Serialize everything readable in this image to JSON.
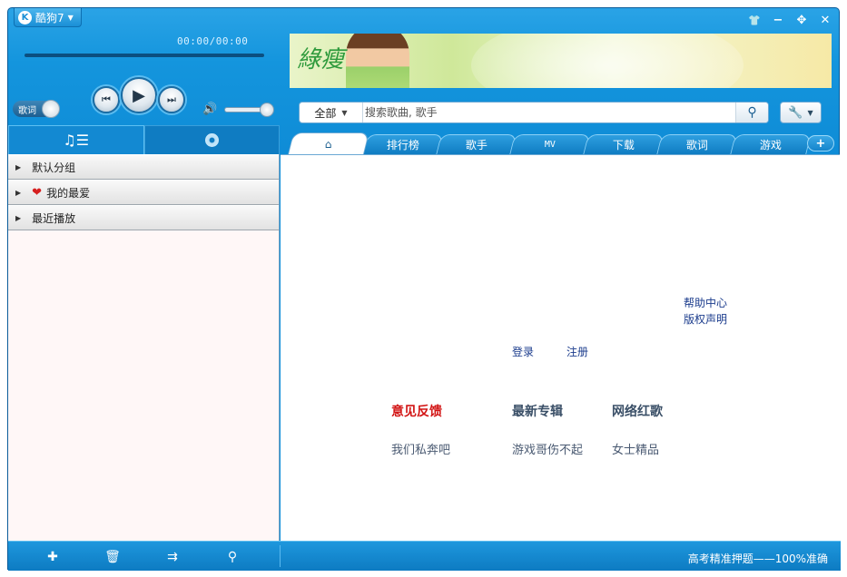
{
  "app": {
    "title": "酷狗7",
    "logo_letter": "K"
  },
  "window_controls": {
    "skin": "👕",
    "minimize": "−",
    "mini_mode": "✥",
    "close": "✕"
  },
  "player": {
    "time": "00:00/00:00",
    "progress": 0,
    "lyric_toggle": "歌词",
    "volume_level": 0.85
  },
  "banner": {
    "text": "綠瘦"
  },
  "search": {
    "scope": "全部",
    "placeholder": "搜索歌曲, 歌手",
    "value": ""
  },
  "left_tabs": [
    {
      "name": "music-list",
      "icon": "music-list-icon",
      "active": true
    },
    {
      "name": "disc",
      "icon": "disc-icon",
      "active": false
    }
  ],
  "groups": [
    {
      "label": "默认分组",
      "icon": null
    },
    {
      "label": "我的最爱",
      "icon": "heart-icon"
    },
    {
      "label": "最近播放",
      "icon": null
    }
  ],
  "tabs": [
    {
      "label": "home",
      "icon": "home-icon"
    },
    {
      "label": "排行榜"
    },
    {
      "label": "歌手"
    },
    {
      "label": "MV"
    },
    {
      "label": "下载"
    },
    {
      "label": "歌词"
    },
    {
      "label": "游戏"
    }
  ],
  "content": {
    "help": "帮助中心",
    "copyright": "版权声明",
    "login": "登录",
    "register": "注册",
    "headings": [
      "意见反馈",
      "最新专辑",
      "网络红歌"
    ],
    "items": [
      "我们私奔吧",
      "游戏哥伤不起",
      "女士精品"
    ]
  },
  "bottom": {
    "status": "高考精准押题——100%准确"
  },
  "colors": {
    "accent": "#1495dd",
    "feedback_red": "#d21414",
    "link": "#1a3b8c"
  }
}
